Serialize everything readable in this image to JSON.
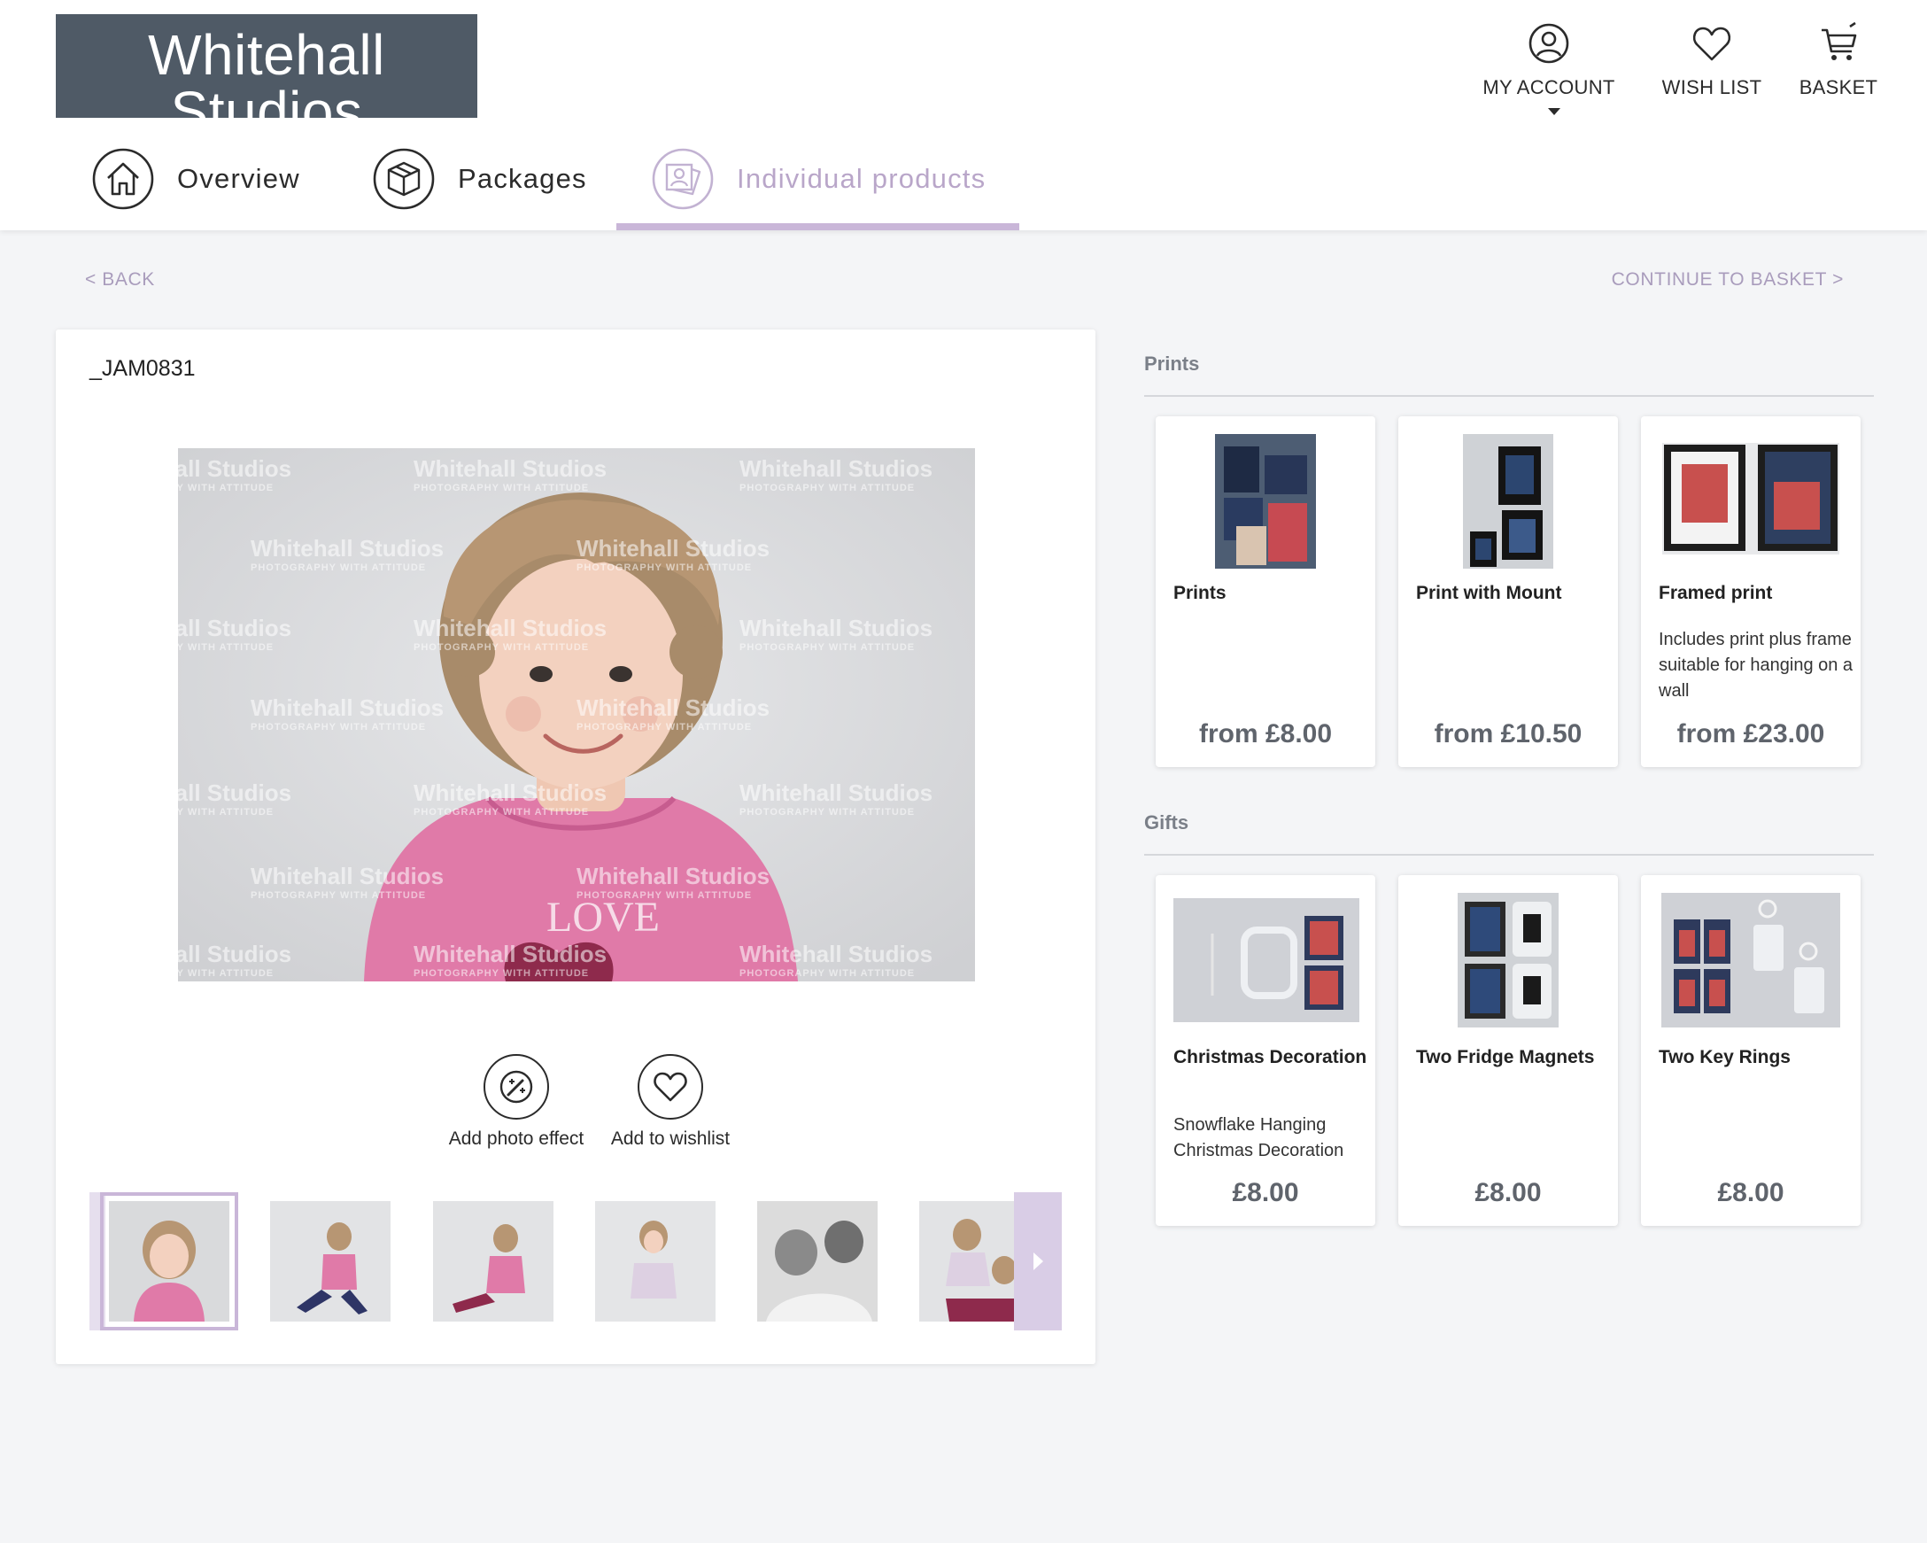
{
  "brand": {
    "name": "Whitehall Studios",
    "tagline": "PHOTOGRAPHY WITH ATTITUDE"
  },
  "top_actions": {
    "account": "MY ACCOUNT",
    "wishlist": "WISH LIST",
    "basket": "BASKET"
  },
  "nav": {
    "tabs": [
      {
        "label": "Overview",
        "icon": "home-icon"
      },
      {
        "label": "Packages",
        "icon": "box-icon"
      },
      {
        "label": "Individual products",
        "icon": "photos-icon",
        "active": true
      }
    ]
  },
  "links": {
    "back": "< BACK",
    "continue": "CONTINUE TO BASKET >"
  },
  "photo": {
    "id": "_JAM0831",
    "watermark_name": "Whitehall Studios",
    "watermark_tag": "PHOTOGRAPHY WITH ATTITUDE",
    "shirt_text": "LOVE"
  },
  "photo_actions": {
    "effect": "Add photo effect",
    "wishlist": "Add to wishlist"
  },
  "sections": {
    "prints": {
      "title": "Prints",
      "items": [
        {
          "name": "Prints",
          "desc": "",
          "price": "from £8.00"
        },
        {
          "name": "Print with Mount",
          "desc": "",
          "price": "from £10.50"
        },
        {
          "name": "Framed print",
          "desc": "Includes print plus frame suitable for hanging on a wall",
          "price": "from £23.00"
        }
      ]
    },
    "gifts": {
      "title": "Gifts",
      "items": [
        {
          "name": "Christmas Decoration",
          "desc": "Snowflake Hanging Christmas Decoration",
          "price": "£8.00"
        },
        {
          "name": "Two Fridge Magnets",
          "desc": "",
          "price": "£8.00"
        },
        {
          "name": "Two Key Rings",
          "desc": "",
          "price": "£8.00"
        }
      ]
    }
  },
  "colors": {
    "accent": "#c9b6d8",
    "logo_bg": "#4f5a66",
    "link": "#a99cbc",
    "price": "#5f646c",
    "shirt": "#e07aa8"
  }
}
